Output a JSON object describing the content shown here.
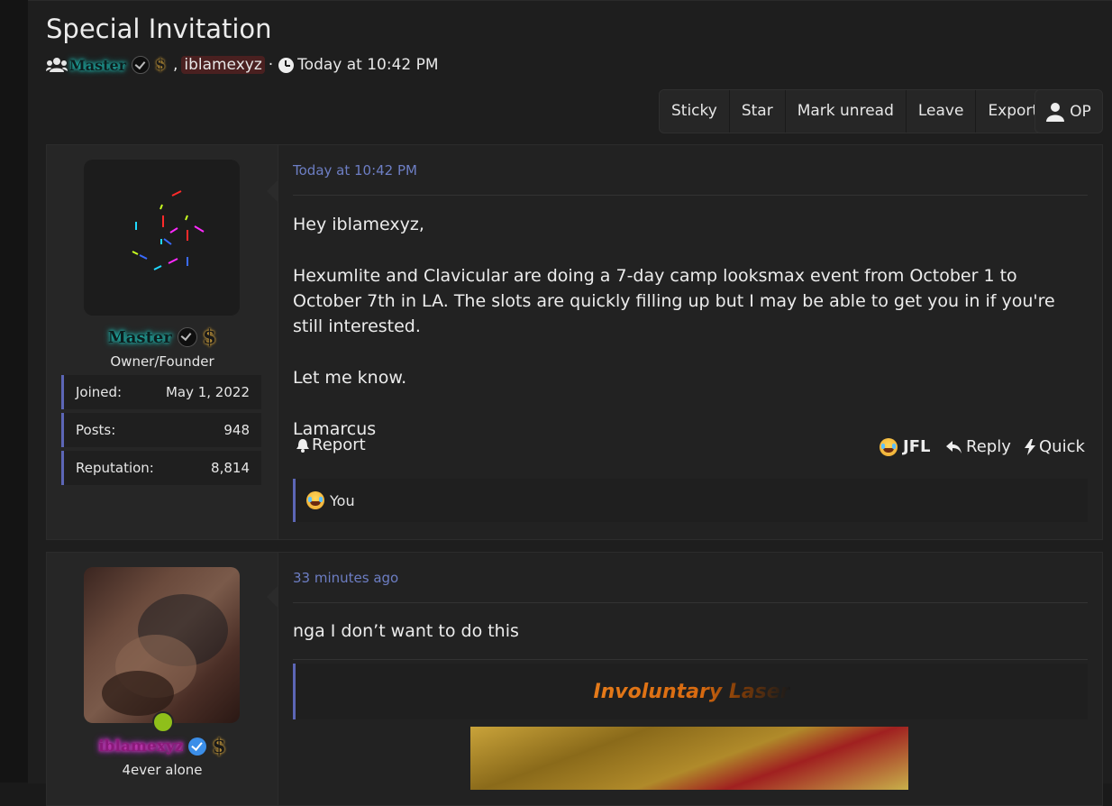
{
  "thread": {
    "title": "Special Invitation",
    "participants": [
      {
        "name": "Master",
        "badge": "verified-dark",
        "extra": "$"
      },
      {
        "name": "iblamexyz"
      }
    ],
    "separator": ",",
    "dot": "·",
    "time": "Today at 10:42 PM"
  },
  "toolbar": {
    "buttons": [
      "Sticky",
      "Star",
      "Mark unread",
      "Leave",
      "Export"
    ],
    "op_label": "OP"
  },
  "posts": [
    {
      "author": "Master",
      "author_title": "Owner/Founder",
      "dollar": "$",
      "stats": [
        {
          "label": "Joined:",
          "value": "May 1, 2022"
        },
        {
          "label": "Posts:",
          "value": "948"
        },
        {
          "label": "Reputation:",
          "value": "8,814"
        }
      ],
      "time": "Today at 10:42 PM",
      "paragraphs": [
        "Hey iblamexyz,",
        "Hexumlite and Clavicular are doing a 7-day camp looksmax event from October 1 to October 7th in LA. The slots are quickly filling up but I may be able to get you in if you're still interested.",
        "Let me know.",
        "Lamarcus"
      ],
      "actions": {
        "report": "Report",
        "jfl": "JFL",
        "reply": "Reply",
        "quick": "Quick"
      },
      "reaction": "You"
    },
    {
      "author": "iblamexyz",
      "author_title": "4ever alone",
      "dollar": "$",
      "time": "33 minutes ago",
      "text": "nga I don’t want to do this",
      "quote": "Involuntary Laser"
    }
  ],
  "colors": {
    "accent": "#5c66b6",
    "link_time": "#6d7ec4",
    "online": "#8fbf1a"
  }
}
